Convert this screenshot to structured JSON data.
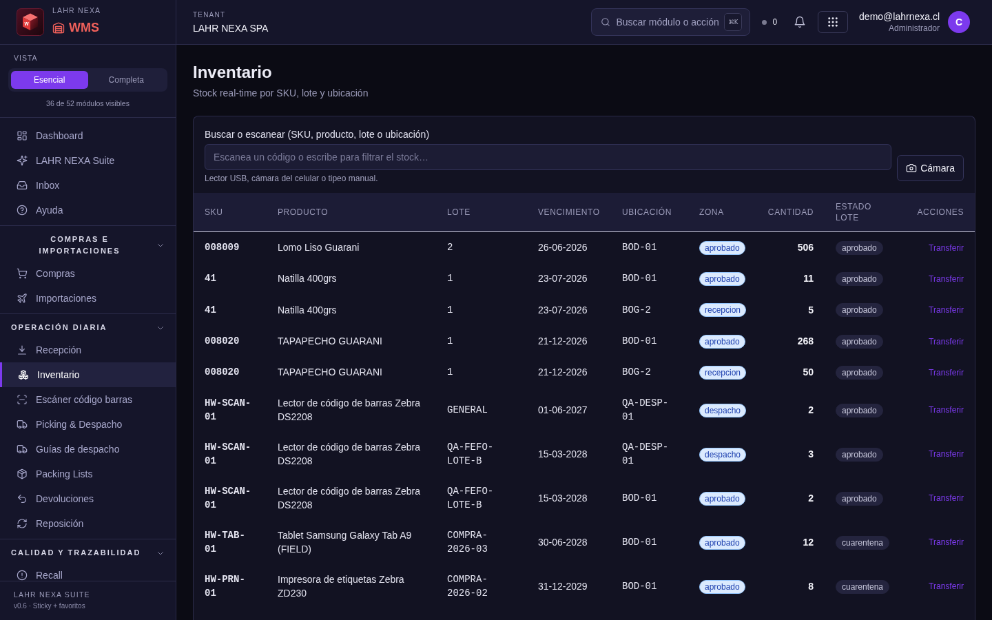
{
  "sidebar": {
    "brand": {
      "logo_letter": "W",
      "overline": "LAHR NEXA",
      "product": "WMS"
    },
    "view": {
      "label": "VISTA",
      "options": [
        {
          "label": "Esencial",
          "selected": true
        },
        {
          "label": "Completa",
          "selected": false
        }
      ],
      "caption": "36 de 52 módulos visibles"
    },
    "sections": [
      {
        "items": [
          {
            "label": "Dashboard",
            "selected": false
          },
          {
            "label": "LAHR NEXA Suite",
            "selected": false
          },
          {
            "label": "Inbox",
            "selected": false
          },
          {
            "label": "Ayuda",
            "selected": false
          }
        ]
      },
      {
        "title": "COMPRAS E IMPORTACIONES",
        "expanded": true,
        "items": [
          {
            "label": "Compras",
            "selected": false
          },
          {
            "label": "Importaciones",
            "selected": false
          }
        ]
      },
      {
        "title": "OPERACIÓN DIARIA",
        "expanded": true,
        "items": [
          {
            "label": "Recepción",
            "selected": false
          },
          {
            "label": "Inventario",
            "selected": true
          },
          {
            "label": "Escáner código barras",
            "selected": false
          },
          {
            "label": "Picking & Despacho",
            "selected": false
          },
          {
            "label": "Guías de despacho",
            "selected": false
          },
          {
            "label": "Packing Lists",
            "selected": false
          },
          {
            "label": "Devoluciones",
            "selected": false
          },
          {
            "label": "Reposición",
            "selected": false
          }
        ]
      },
      {
        "title": "CALIDAD Y TRAZABILIDAD",
        "expanded": true,
        "items": [
          {
            "label": "Recall",
            "selected": false
          }
        ]
      }
    ],
    "footer": {
      "title": "LAHR NEXA SUITE",
      "subtitle": "v0.6 · Sticky + favoritos"
    }
  },
  "header": {
    "tenant_label": "TENANT",
    "tenant_name": "LAHR NEXA SPA",
    "search": {
      "placeholder": "Buscar módulo o acción",
      "shortcut": "⌘K"
    },
    "status_count": "0",
    "user": {
      "email": "demo@lahrnexa.cl",
      "role": "Administrador",
      "initial": "C"
    }
  },
  "page": {
    "title": "Inventario",
    "subtitle": "Stock real-time por SKU, lote y ubicación"
  },
  "scanner": {
    "label": "Buscar o escanear (SKU, producto, lote o ubicación)",
    "placeholder": "Escanea un código o escribe para filtrar el stock…",
    "hint": "Lector USB, cámara del celular o tipeo manual.",
    "camera_button": "Cámara"
  },
  "table": {
    "columns": [
      "SKU",
      "PRODUCTO",
      "LOTE",
      "VENCIMIENTO",
      "UBICACIÓN",
      "ZONA",
      "CANTIDAD",
      "ESTADO LOTE",
      "ACCIONES"
    ],
    "rows": [
      {
        "sku": "008009",
        "product": "Lomo Liso Guarani",
        "lot": "2",
        "expiry": "26-06-2026",
        "location": "BOD-01",
        "zone": "aprobado",
        "quantity": "506",
        "lot_status": "aprobado",
        "action": "Transferir"
      },
      {
        "sku": "41",
        "product": "Natilla 400grs",
        "lot": "1",
        "expiry": "23-07-2026",
        "location": "BOD-01",
        "zone": "aprobado",
        "quantity": "11",
        "lot_status": "aprobado",
        "action": "Transferir"
      },
      {
        "sku": "41",
        "product": "Natilla 400grs",
        "lot": "1",
        "expiry": "23-07-2026",
        "location": "BOG-2",
        "zone": "recepcion",
        "quantity": "5",
        "lot_status": "aprobado",
        "action": "Transferir"
      },
      {
        "sku": "008020",
        "product": "TAPAPECHO GUARANI",
        "lot": "1",
        "expiry": "21-12-2026",
        "location": "BOD-01",
        "zone": "aprobado",
        "quantity": "268",
        "lot_status": "aprobado",
        "action": "Transferir"
      },
      {
        "sku": "008020",
        "product": "TAPAPECHO GUARANI",
        "lot": "1",
        "expiry": "21-12-2026",
        "location": "BOG-2",
        "zone": "recepcion",
        "quantity": "50",
        "lot_status": "aprobado",
        "action": "Transferir"
      },
      {
        "sku": "HW-SCAN-01",
        "product": "Lector de código de barras Zebra DS2208",
        "lot": "GENERAL",
        "expiry": "01-06-2027",
        "location": "QA-DESP-01",
        "zone": "despacho",
        "quantity": "2",
        "lot_status": "aprobado",
        "action": "Transferir"
      },
      {
        "sku": "HW-SCAN-01",
        "product": "Lector de código de barras Zebra DS2208",
        "lot": "QA-FEFO-LOTE-B",
        "expiry": "15-03-2028",
        "location": "QA-DESP-01",
        "zone": "despacho",
        "quantity": "3",
        "lot_status": "aprobado",
        "action": "Transferir"
      },
      {
        "sku": "HW-SCAN-01",
        "product": "Lector de código de barras Zebra DS2208",
        "lot": "QA-FEFO-LOTE-B",
        "expiry": "15-03-2028",
        "location": "BOD-01",
        "zone": "aprobado",
        "quantity": "2",
        "lot_status": "aprobado",
        "action": "Transferir"
      },
      {
        "sku": "HW-TAB-01",
        "product": "Tablet Samsung Galaxy Tab A9 (FIELD)",
        "lot": "COMPRA-2026-03",
        "expiry": "30-06-2028",
        "location": "BOD-01",
        "zone": "aprobado",
        "quantity": "12",
        "lot_status": "cuarentena",
        "action": "Transferir"
      },
      {
        "sku": "HW-PRN-01",
        "product": "Impresora de etiquetas Zebra ZD230",
        "lot": "COMPRA-2026-02",
        "expiry": "31-12-2029",
        "location": "BOD-01",
        "zone": "aprobado",
        "quantity": "8",
        "lot_status": "cuarentena",
        "action": "Transferir"
      }
    ]
  }
}
